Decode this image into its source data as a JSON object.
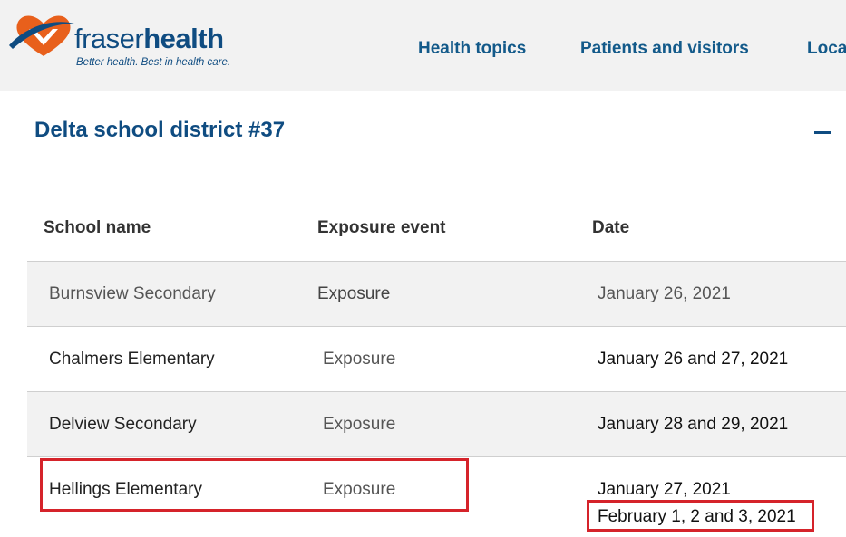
{
  "brand": {
    "name_light": "fraser",
    "name_bold": "health",
    "tagline": "Better health. Best in health care.",
    "color_primary": "#0f4c81",
    "color_accent": "#e8601c"
  },
  "nav": {
    "items": [
      {
        "label": "Health topics"
      },
      {
        "label": "Patients and visitors"
      },
      {
        "label": "Loca"
      }
    ]
  },
  "section": {
    "title": "Delta school district #37",
    "collapse_icon": "minus-icon"
  },
  "table": {
    "headers": [
      "School name",
      "Exposure event",
      "Date"
    ],
    "rows": [
      {
        "school": "Burnsview Secondary",
        "event": "Exposure",
        "date": "January 26, 2021"
      },
      {
        "school": "Chalmers Elementary",
        "event": "Exposure",
        "date": "January 26 and 27, 2021"
      },
      {
        "school": "Delview Secondary",
        "event": "Exposure",
        "date": "January 28 and 29, 2021"
      },
      {
        "school": "Hellings Elementary",
        "event": "Exposure",
        "date": "January 27, 2021",
        "date_extra": "February 1, 2 and 3, 2021"
      }
    ]
  },
  "annotations": {
    "highlight_color": "#d5232a"
  }
}
